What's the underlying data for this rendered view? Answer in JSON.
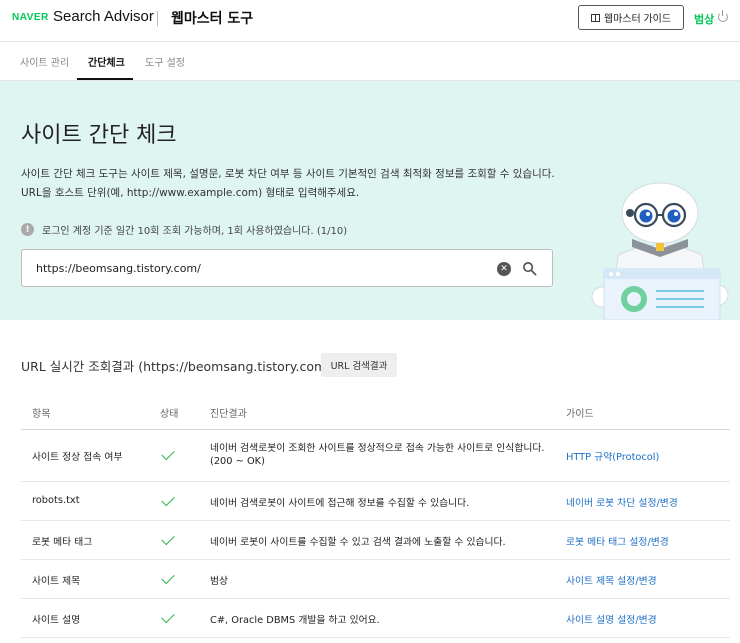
{
  "header": {
    "naver": "NAVER",
    "brand": "Search Advisor",
    "subtitle": "웹마스터 도구",
    "guide_button": "웹마스터 가이드",
    "user": "범상"
  },
  "tabs": [
    {
      "label": "사이트 관리",
      "active": false
    },
    {
      "label": "간단체크",
      "active": true
    },
    {
      "label": "도구 설정",
      "active": false
    }
  ],
  "hero": {
    "title": "사이트 간단 체크",
    "desc_line1": "사이트 간단 체크 도구는 사이트 제목, 설명문, 로봇 차단 여부 등 사이트 기본적인 검색 최적화 정보를 조회할 수 있습니다.",
    "desc_line2": "URL을 호스트 단위(예, http://www.example.com) 형태로 입력해주세요.",
    "notice": "로그인 계정 기준 일간 10회 조회 가능하며, 1회 사용하였습니다. (1/10)",
    "search_value": "https://beomsang.tistory.com/"
  },
  "results": {
    "heading": "URL 실시간 조회결과 (https://beomsang.tistory.com/)",
    "url_button": "URL 검색결과",
    "columns": [
      "항목",
      "상태",
      "진단결과",
      "가이드"
    ],
    "rows": [
      {
        "item": "사이트 정상 접속 여부",
        "result1": "네이버 검색로봇이 조회한 사이트를 정상적으로 접속 가능한 사이트로 인식합니다.",
        "result2": "(200 ~ OK)",
        "guide": "HTTP 규약(Protocol)"
      },
      {
        "item": "robots.txt",
        "result1": "네이버 검색로봇이 사이트에 접근해 정보를 수집할 수 있습니다.",
        "result2": "",
        "guide": "네이버 로봇 차단 설정/변경"
      },
      {
        "item": "로봇 메타 태그",
        "result1": "네이버 로봇이 사이트를 수집할 수 있고 검색 결과에 노출할 수 있습니다.",
        "result2": "",
        "guide": "로봇 메타 태그 설정/변경"
      },
      {
        "item": "사이트 제목",
        "result1": "범상",
        "result2": "",
        "guide": "사이트 제목 설정/변경"
      },
      {
        "item": "사이트 설명",
        "result1": "C#, Oracle DBMS 개발을 하고 있어요.",
        "result2": "",
        "guide": "사이트 설명 설정/변경"
      }
    ]
  },
  "colors": {
    "accent": "#03c75a",
    "hero_bg": "#dff5f2",
    "link": "#1b6fc5",
    "check": "#2db84a"
  }
}
